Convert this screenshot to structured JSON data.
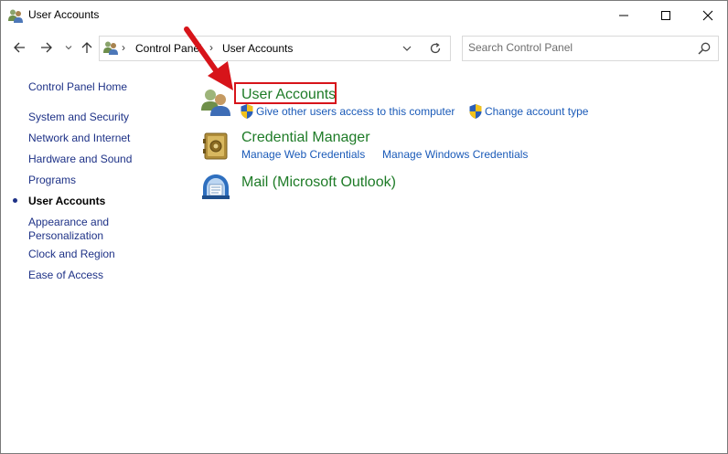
{
  "window": {
    "title": "User Accounts"
  },
  "address": {
    "segments": [
      "Control Panel",
      "User Accounts"
    ],
    "separator": "›"
  },
  "search": {
    "placeholder": "Search Control Panel",
    "value": ""
  },
  "leftnav": {
    "home": "Control Panel Home",
    "items": [
      {
        "label": "System and Security",
        "current": false
      },
      {
        "label": "Network and Internet",
        "current": false
      },
      {
        "label": "Hardware and Sound",
        "current": false
      },
      {
        "label": "Programs",
        "current": false
      },
      {
        "label": "User Accounts",
        "current": true
      },
      {
        "label": "Appearance and",
        "label2": "Personalization",
        "current": false
      },
      {
        "label": "Clock and Region",
        "current": false
      },
      {
        "label": "Ease of Access",
        "current": false
      }
    ]
  },
  "categories": [
    {
      "title": "User Accounts",
      "icon": "user-accounts-icon",
      "links": [
        "Give other users access to this computer",
        "Change account type"
      ]
    },
    {
      "title": "Credential Manager",
      "icon": "credential-manager-icon",
      "links": [
        "Manage Web Credentials",
        "Manage Windows Credentials"
      ]
    },
    {
      "title": "Mail (Microsoft Outlook)",
      "icon": "mail-icon",
      "links": []
    }
  ],
  "colors": {
    "link": "#1a5ab8",
    "category_title": "#1e7b27",
    "nav_link": "#1e3287",
    "annotation": "#d7141a"
  }
}
